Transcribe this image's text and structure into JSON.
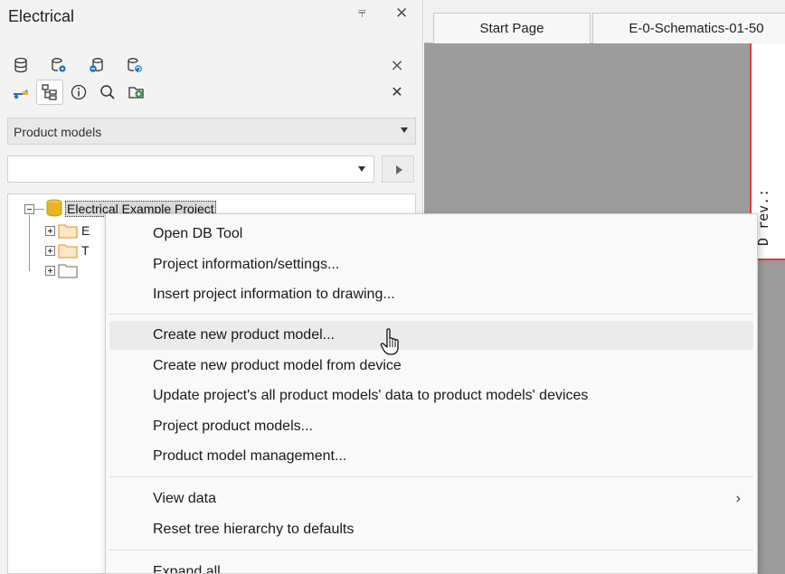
{
  "panel": {
    "title": "Electrical",
    "pin_glyph": "⫧",
    "close_glyph": "✕",
    "toolbar_row1": [
      "database-icon",
      "database-settings-icon",
      "database-link-icon",
      "database-refresh-icon"
    ],
    "toolbar_row2": [
      "settings-wrench-icon",
      "tree-view-icon",
      "info-icon",
      "search-icon",
      "add-folder-icon"
    ],
    "collapse_glyph": "⨯",
    "close2_glyph": "✕",
    "view_selector": {
      "value": "Product models"
    },
    "search": {
      "value": ""
    }
  },
  "tree": {
    "root_label": "Electrical Example Project",
    "children": [
      {
        "label_partial": "E",
        "expander": "plus"
      },
      {
        "label_partial": "T",
        "expander": "plus"
      },
      {
        "label_partial": "",
        "expander": "plus"
      }
    ]
  },
  "document": {
    "tabs": [
      "Start Page",
      "E-0-Schematics-01-50"
    ],
    "sheet_text": "D rev.:"
  },
  "context_menu": {
    "items": [
      {
        "label": "Open DB Tool"
      },
      {
        "label": "Project information/settings..."
      },
      {
        "label": "Insert project information to drawing..."
      },
      {
        "label": "Create new product model...",
        "hovered": true
      },
      {
        "label": "Create new product model from device"
      },
      {
        "label": "Update project's all product models' data to product models' devices"
      },
      {
        "label": "Project product models..."
      },
      {
        "label": "Product model management..."
      },
      {
        "label": "View data",
        "submenu": true
      },
      {
        "label": "Reset tree hierarchy to defaults"
      },
      {
        "label": "Expand all"
      }
    ],
    "submenu_glyph": "›"
  },
  "colors": {
    "accent_red": "#e03a3a",
    "db_yellow": "#e8b422",
    "folder_orange": "#e8a04a",
    "icon_blue": "#1f6fc7",
    "add_green": "#2ea043"
  }
}
